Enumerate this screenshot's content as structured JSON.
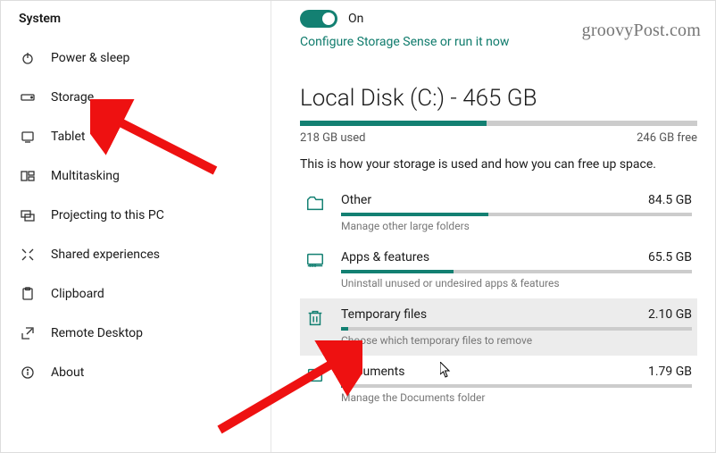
{
  "sidebar": {
    "title": "System",
    "items": [
      {
        "label": "Power & sleep"
      },
      {
        "label": "Storage"
      },
      {
        "label": "Tablet"
      },
      {
        "label": "Multitasking"
      },
      {
        "label": "Projecting to this PC"
      },
      {
        "label": "Shared experiences"
      },
      {
        "label": "Clipboard"
      },
      {
        "label": "Remote Desktop"
      },
      {
        "label": "About"
      }
    ]
  },
  "toggle": {
    "label": "On"
  },
  "config_link": "Configure Storage Sense or run it now",
  "disk": {
    "title": "Local Disk (C:) - 465 GB",
    "used": "218 GB used",
    "free": "246 GB free",
    "fill_pct": 47
  },
  "explain": "This is how your storage is used and how you can free up space.",
  "categories": [
    {
      "name": "Other",
      "size": "84.5 GB",
      "sub": "Manage other large folders",
      "fill_pct": 42
    },
    {
      "name": "Apps & features",
      "size": "65.5 GB",
      "sub": "Uninstall unused or undesired apps & features",
      "fill_pct": 32
    },
    {
      "name": "Temporary files",
      "size": "2.10 GB",
      "sub": "Choose which temporary files to remove",
      "fill_pct": 2
    },
    {
      "name": "Documents",
      "size": "1.79 GB",
      "sub": "Manage the Documents folder",
      "fill_pct": 2
    }
  ],
  "watermark": "groovyPost.com"
}
